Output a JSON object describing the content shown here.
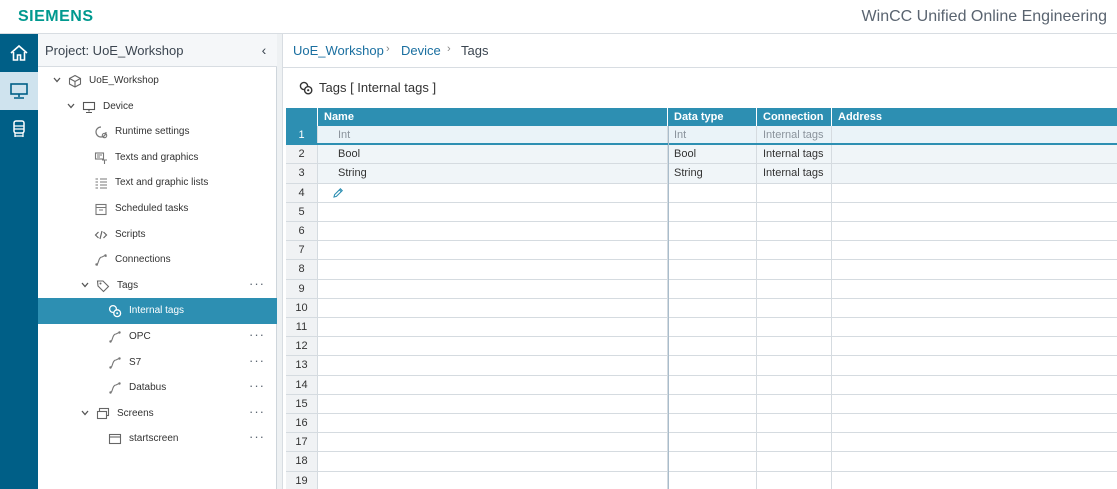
{
  "header": {
    "brand": "SIEMENS",
    "app_title": "WinCC Unified Online Engineering"
  },
  "rail": {
    "items": [
      {
        "icon": "home-icon"
      },
      {
        "icon": "device-icon",
        "active": true
      },
      {
        "icon": "runtime-icon"
      }
    ]
  },
  "tree": {
    "title": "Project: UoE_Workshop",
    "collapse_glyph": "‹",
    "items": [
      {
        "label": "UoE_Workshop",
        "level": 0,
        "expanded": true,
        "icon": "project-icon"
      },
      {
        "label": "Device",
        "level": 1,
        "expanded": true,
        "icon": "device-icon"
      },
      {
        "label": "Runtime settings",
        "level": 2,
        "icon": "runtime-settings-icon"
      },
      {
        "label": "Texts and graphics",
        "level": 2,
        "icon": "texts-graphics-icon"
      },
      {
        "label": "Text and graphic lists",
        "level": 2,
        "icon": "text-lists-icon"
      },
      {
        "label": "Scheduled tasks",
        "level": 2,
        "icon": "scheduled-tasks-icon"
      },
      {
        "label": "Scripts",
        "level": 2,
        "icon": "scripts-icon"
      },
      {
        "label": "Connections",
        "level": 2,
        "icon": "connections-icon"
      },
      {
        "label": "Tags",
        "level": 2,
        "expanded": true,
        "icon": "tag-icon",
        "more": "···"
      },
      {
        "label": "Internal tags",
        "level": 3,
        "selected": true,
        "icon": "internal-tags-icon"
      },
      {
        "label": "OPC",
        "level": 3,
        "icon": "connection-icon",
        "more": "···"
      },
      {
        "label": "S7",
        "level": 3,
        "icon": "connection-icon",
        "more": "···"
      },
      {
        "label": "Databus",
        "level": 3,
        "icon": "connection-icon",
        "more": "···"
      },
      {
        "label": "Screens",
        "level": 2,
        "expanded": true,
        "icon": "screens-icon",
        "more": "···"
      },
      {
        "label": "startscreen",
        "level": 3,
        "icon": "screen-icon",
        "more": "···"
      }
    ]
  },
  "breadcrumb": {
    "items": [
      "UoE_Workshop",
      "Device",
      "Tags"
    ],
    "separator": "›"
  },
  "editor": {
    "title": "Tags [ Internal tags ]"
  },
  "table": {
    "columns": [
      "Name",
      "Data type",
      "Connection",
      "Address"
    ],
    "rows": [
      {
        "num": "1",
        "name": "Int",
        "data_type": "Int",
        "connection": "Internal tags",
        "address": ""
      },
      {
        "num": "2",
        "name": "Bool",
        "data_type": "Bool",
        "connection": "Internal tags",
        "address": ""
      },
      {
        "num": "3",
        "name": "String",
        "data_type": "String",
        "connection": "Internal tags",
        "address": ""
      },
      {
        "num": "4"
      },
      {
        "num": "5"
      },
      {
        "num": "6"
      },
      {
        "num": "7"
      },
      {
        "num": "8"
      },
      {
        "num": "9"
      },
      {
        "num": "10"
      },
      {
        "num": "11"
      },
      {
        "num": "12"
      },
      {
        "num": "13"
      },
      {
        "num": "14"
      },
      {
        "num": "15"
      },
      {
        "num": "16"
      },
      {
        "num": "17"
      },
      {
        "num": "18"
      },
      {
        "num": "19"
      }
    ]
  },
  "colors": {
    "rail": "#005f87",
    "accent": "#2d8fb2",
    "brand": "#00998f"
  }
}
